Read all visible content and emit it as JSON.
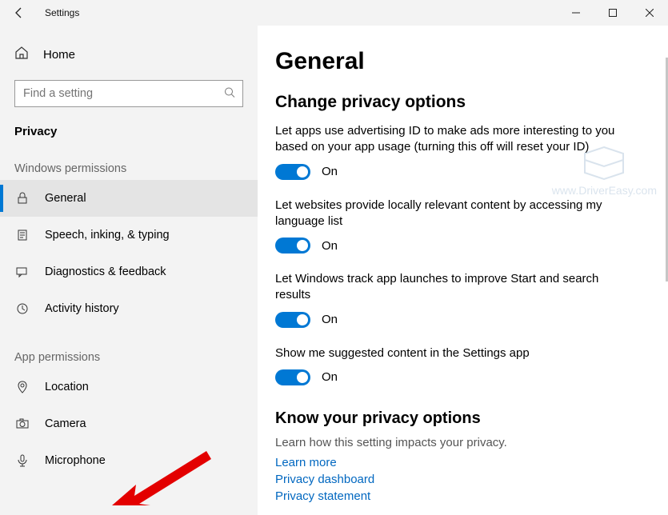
{
  "window": {
    "title": "Settings"
  },
  "sidebar": {
    "home": "Home",
    "search_placeholder": "Find a setting",
    "section_header": "Privacy",
    "group_windows": "Windows permissions",
    "group_app": "App permissions",
    "items_win": [
      {
        "label": "General"
      },
      {
        "label": "Speech, inking, & typing"
      },
      {
        "label": "Diagnostics & feedback"
      },
      {
        "label": "Activity history"
      }
    ],
    "items_app": [
      {
        "label": "Location"
      },
      {
        "label": "Camera"
      },
      {
        "label": "Microphone"
      }
    ]
  },
  "main": {
    "title": "General",
    "subheading": "Change privacy options",
    "opts": [
      {
        "desc": "Let apps use advertising ID to make ads more interesting to you based on your app usage (turning this off will reset your ID)",
        "state": "On"
      },
      {
        "desc": "Let websites provide locally relevant content by accessing my language list",
        "state": "On"
      },
      {
        "desc": "Let Windows track app launches to improve Start and search results",
        "state": "On"
      },
      {
        "desc": "Show me suggested content in the Settings app",
        "state": "On"
      }
    ],
    "know": {
      "heading": "Know your privacy options",
      "hint": "Learn how this setting impacts your privacy.",
      "links": [
        "Learn more",
        "Privacy dashboard",
        "Privacy statement"
      ]
    }
  },
  "watermark": "www.DriverEasy.com"
}
